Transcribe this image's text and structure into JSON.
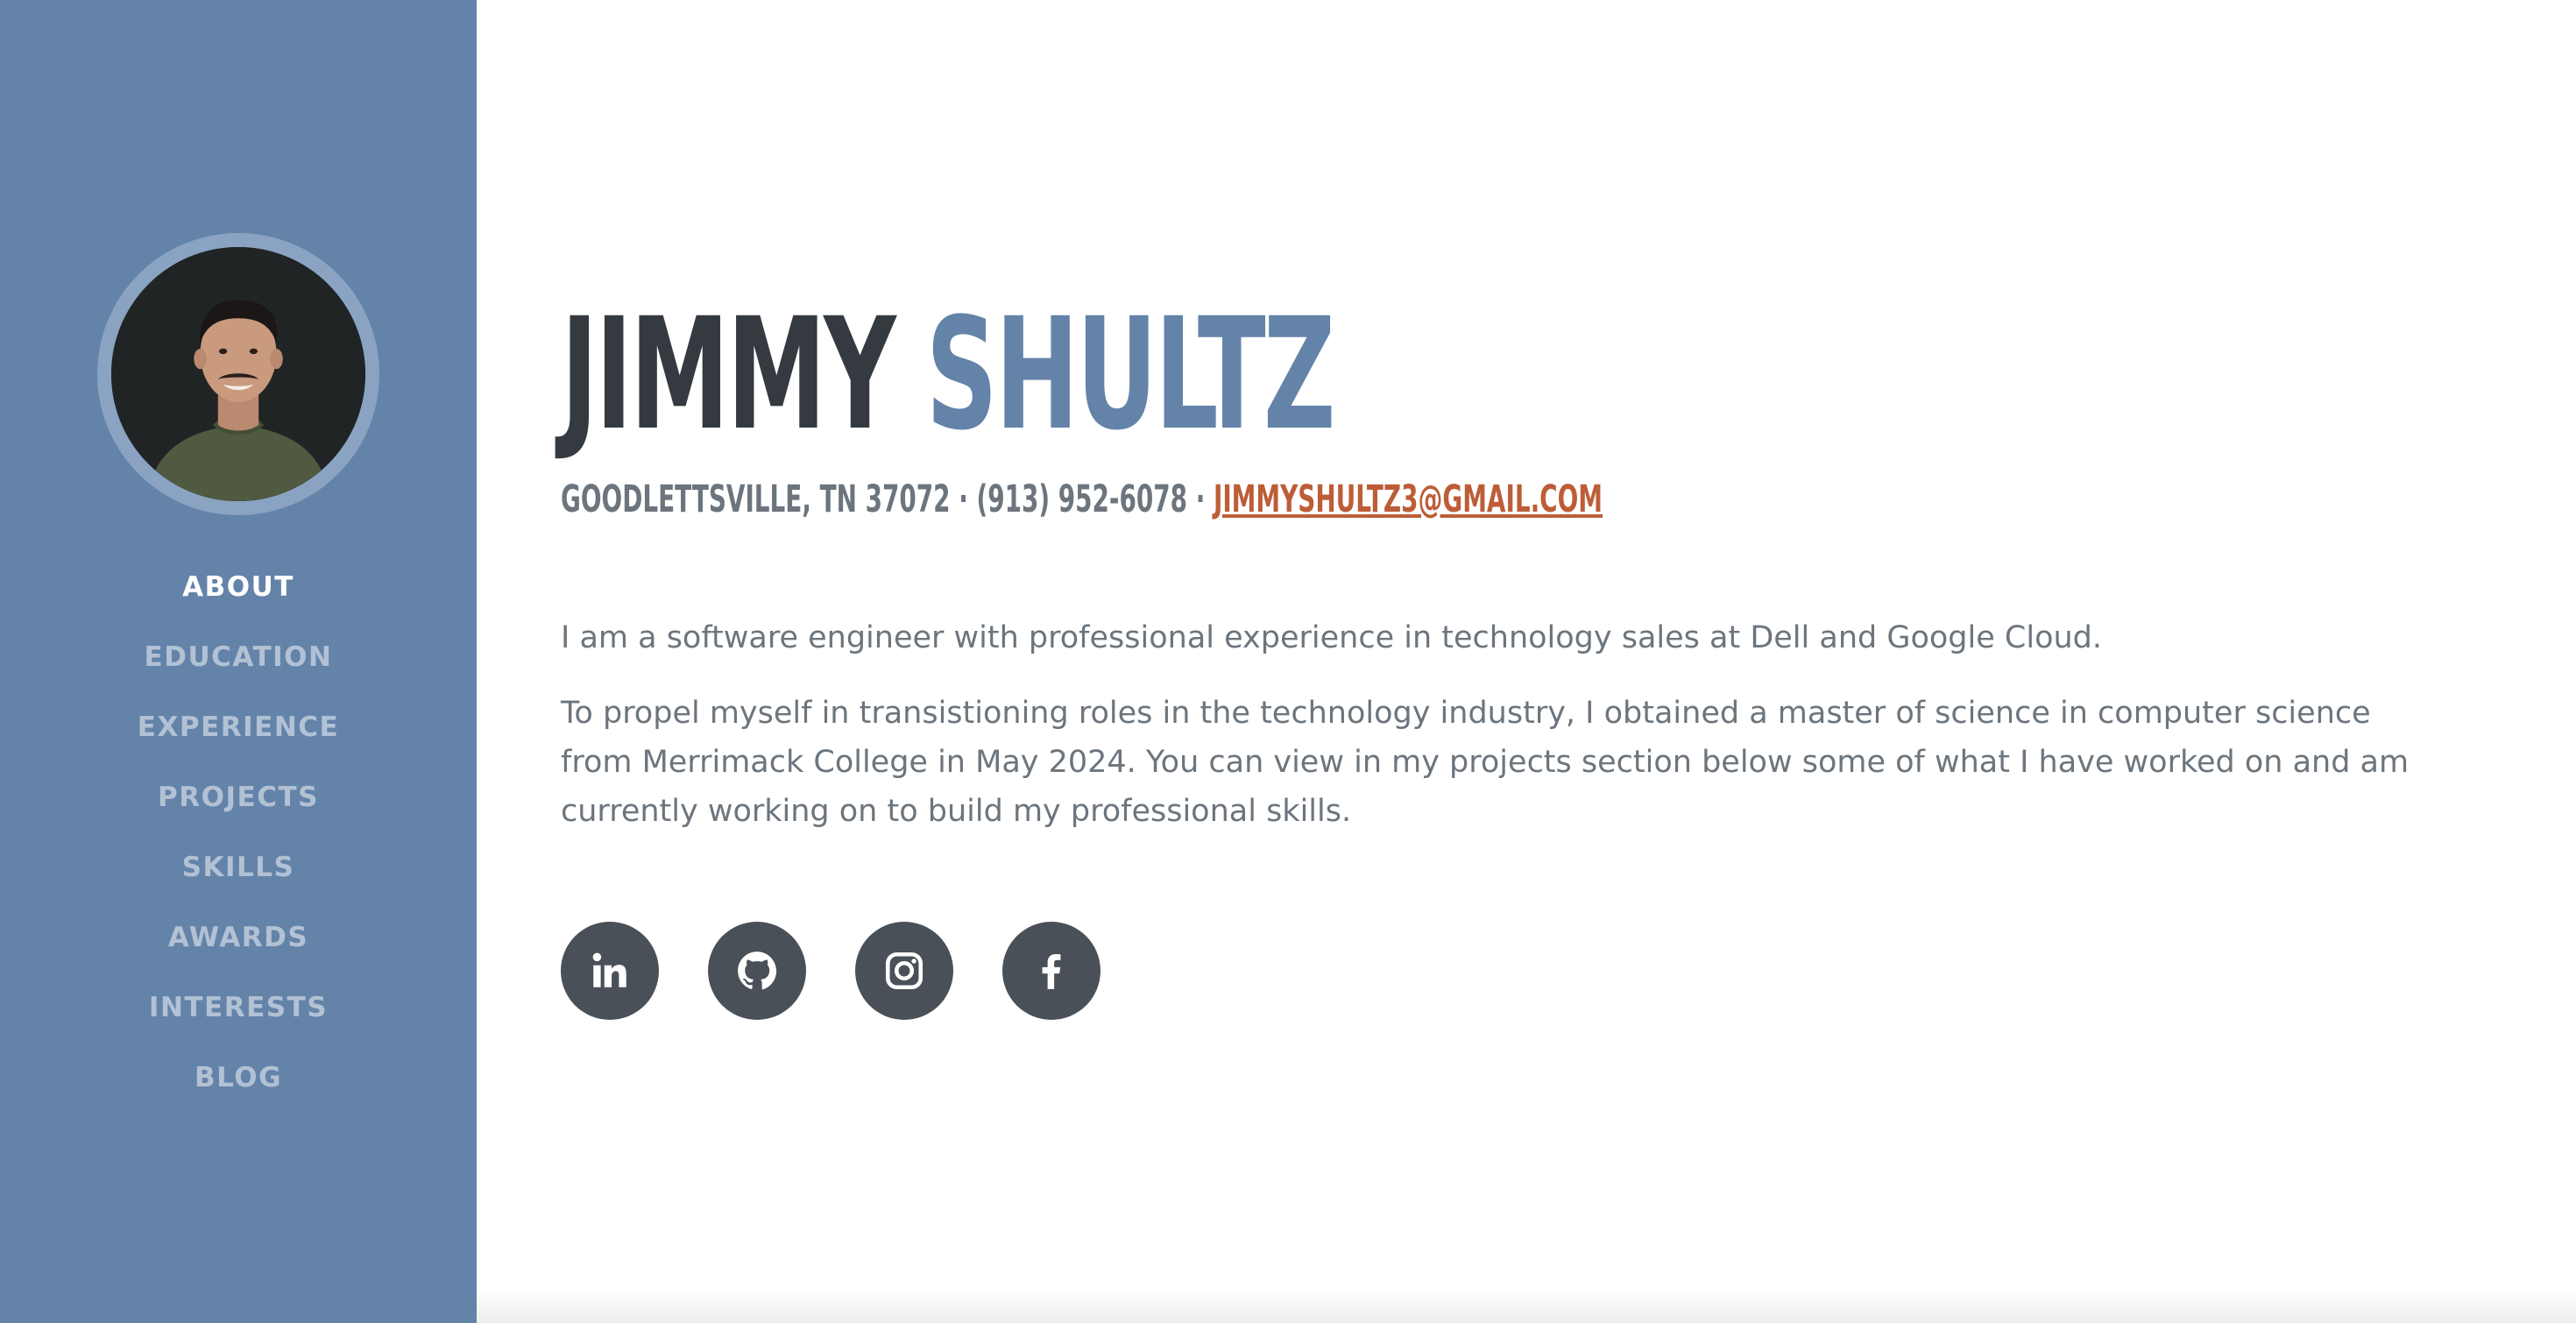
{
  "profile": {
    "first_name": "JIMMY",
    "last_name": "SHULTZ",
    "location": "GOODLETTSVILLE, TN 37072",
    "separator": " · ",
    "phone": "(913) 952-6078",
    "email": "JIMMYSHULTZ3@GMAIL.COM",
    "avatar_alt": "Profile photo"
  },
  "nav": {
    "items": [
      {
        "label": "ABOUT"
      },
      {
        "label": "EDUCATION"
      },
      {
        "label": "EXPERIENCE"
      },
      {
        "label": "PROJECTS"
      },
      {
        "label": "SKILLS"
      },
      {
        "label": "AWARDS"
      },
      {
        "label": "INTERESTS"
      },
      {
        "label": "BLOG"
      }
    ],
    "active": "ABOUT"
  },
  "bio": {
    "paragraphs": [
      "I am a software engineer with professional experience in technology sales at Dell and Google Cloud.",
      "To propel myself in transistioning roles in the technology industry, I obtained a master of science in computer science from Merrimack College in May 2024. You can view in my projects section below some of what I have worked on and am currently working on to build my professional skills."
    ]
  },
  "socials": [
    {
      "icon": "linkedin-icon"
    },
    {
      "icon": "github-icon"
    },
    {
      "icon": "instagram-icon"
    },
    {
      "icon": "facebook-icon"
    }
  ],
  "colors": {
    "sidebar": "#6483a9",
    "primary_dark": "#343a40",
    "accent_blue": "#6483a9",
    "email_accent": "#bd5d38",
    "body_text": "#6c757d",
    "social_bg": "#495057"
  }
}
